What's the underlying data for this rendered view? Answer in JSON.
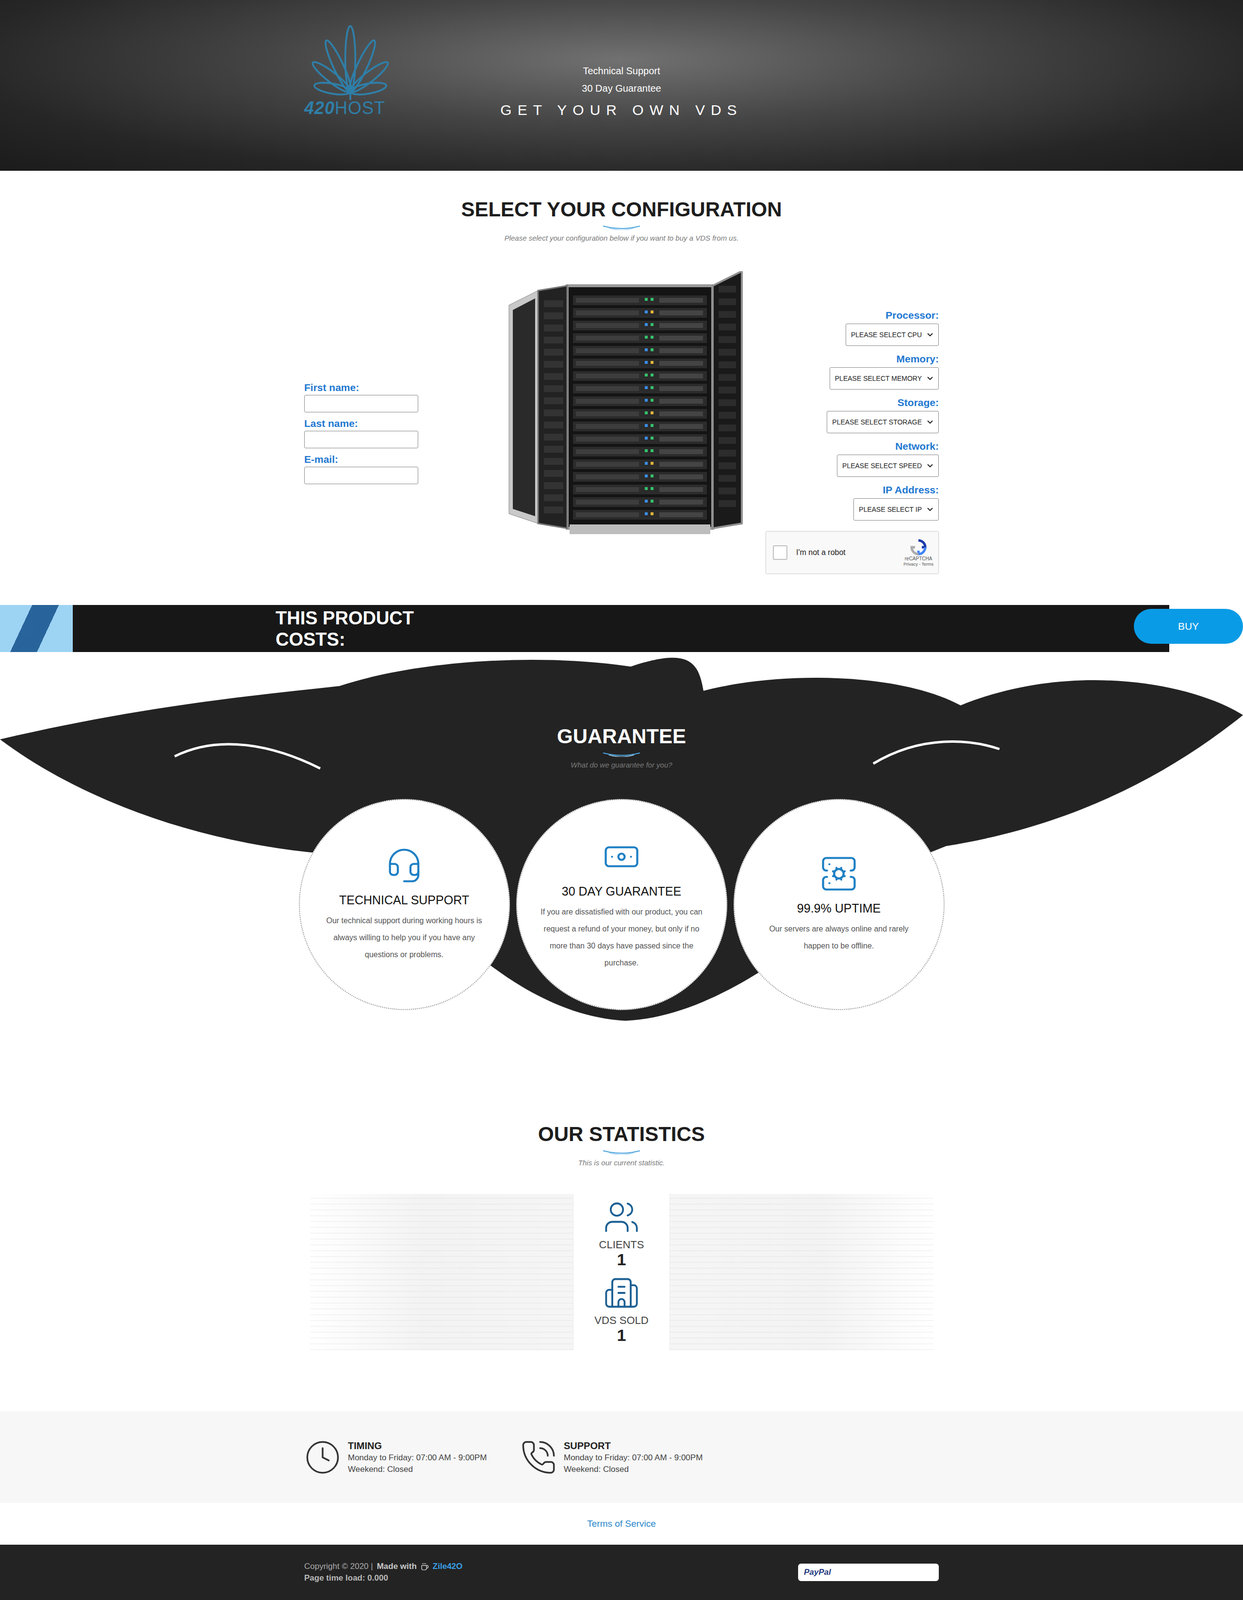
{
  "header": {
    "logo": {
      "number": "420",
      "word": "HOST"
    },
    "taglines": [
      "Technical Support",
      "30 Day Guarantee"
    ],
    "headline": "GET YOUR OWN VDS"
  },
  "configuration": {
    "title": "SELECT YOUR CONFIGURATION",
    "subtitle": "Please select your configuration below if you want to buy a VDS from us.",
    "fields": [
      {
        "label": "First name:",
        "value": ""
      },
      {
        "label": "Last name:",
        "value": ""
      },
      {
        "label": "E-mail:",
        "value": ""
      }
    ],
    "selects": [
      {
        "label": "Processor:",
        "placeholder": "PLEASE SELECT CPU"
      },
      {
        "label": "Memory:",
        "placeholder": "PLEASE SELECT MEMORY"
      },
      {
        "label": "Storage:",
        "placeholder": "PLEASE SELECT STORAGE"
      },
      {
        "label": "Network:",
        "placeholder": "PLEASE SELECT SPEED"
      },
      {
        "label": "IP Address:",
        "placeholder": "PLEASE SELECT IP"
      }
    ],
    "captcha": {
      "label": "I'm not a robot",
      "brand": "reCAPTCHA",
      "links": "Privacy - Terms",
      "checked": false
    }
  },
  "price": {
    "label_lines": [
      "THIS PRODUCT",
      "COSTS:"
    ],
    "button": "BUY"
  },
  "guarantee": {
    "title": "GUARANTEE",
    "subtitle": "What do we guarantee for you?",
    "cards": [
      {
        "title": "TECHNICAL SUPPORT",
        "text": "Our technical support during working hours is always willing to help you if you have any questions or problems."
      },
      {
        "title": "30 DAY GUARANTEE",
        "text": "If you are dissatisfied with our product, you can request a refund of your money, but only if no more than 30 days have passed since the purchase."
      },
      {
        "title": "99.9% UPTIME",
        "text": "Our servers are always online and rarely happen to be offline."
      }
    ]
  },
  "statistics": {
    "title": "OUR STATISTICS",
    "subtitle": "This is our current statistic.",
    "items": [
      {
        "label": "CLIENTS",
        "value": "1"
      },
      {
        "label": "VDS SOLD",
        "value": "1"
      }
    ]
  },
  "info": [
    {
      "title": "TIMING",
      "lines": [
        "Monday to Friday: 07:00 AM - 9:00PM",
        "Weekend: Closed"
      ]
    },
    {
      "title": "SUPPORT",
      "lines": [
        "Monday to Friday: 07:00 AM - 9:00PM",
        "Weekend: Closed"
      ]
    }
  ],
  "terms": "Terms of Service",
  "footer": {
    "copyright": "Copyright © 2020 |",
    "made_with": "Made with",
    "author": "Zile42O",
    "load": "Page time load: 0.000",
    "payment": "PayPal"
  }
}
